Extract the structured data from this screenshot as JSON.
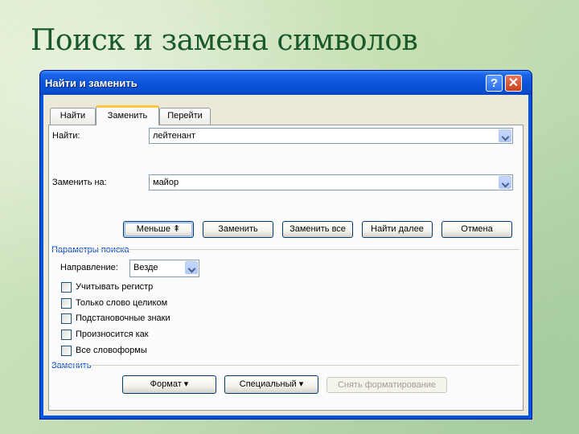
{
  "slide": {
    "title": "Поиск и замена символов"
  },
  "dialog": {
    "title": "Найти и заменить",
    "help_glyph": "?",
    "close_glyph": "✕",
    "tabs": [
      {
        "label": "Найти",
        "active": false
      },
      {
        "label": "Заменить",
        "active": true
      },
      {
        "label": "Перейти",
        "active": false
      }
    ],
    "find": {
      "label": "Найти:",
      "value": "лейтенант"
    },
    "replace": {
      "label": "Заменить на:",
      "value": "майор"
    },
    "buttons": {
      "less": "Меньше ⇞",
      "replace": "Заменить",
      "replace_all": "Заменить все",
      "find_next": "Найти далее",
      "cancel": "Отмена"
    },
    "search_options": {
      "title": "Параметры поиска",
      "direction_label": "Направление:",
      "direction_value": "Везде",
      "checkboxes": [
        {
          "label": "Учитывать регистр",
          "checked": false
        },
        {
          "label": "Только слово целиком",
          "checked": false
        },
        {
          "label": "Подстановочные знаки",
          "checked": false
        },
        {
          "label": "Произносится как",
          "checked": false
        },
        {
          "label": "Все словоформы",
          "checked": false
        }
      ]
    },
    "replace_section": {
      "title": "Заменить",
      "format_button": "Формат ▾",
      "special_button": "Специальный ▾",
      "clear_formatting_button": "Снять форматирование"
    }
  }
}
